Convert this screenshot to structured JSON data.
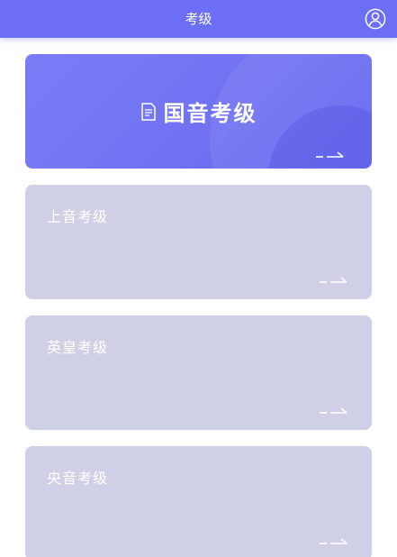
{
  "header": {
    "title": "考级",
    "user_icon": "user-icon"
  },
  "cards": [
    {
      "label": "国音考级",
      "style": "featured",
      "icon": "document-icon",
      "arrow_icon": "arrow-right-icon"
    },
    {
      "label": "上音考级",
      "style": "plain",
      "arrow_icon": "arrow-right-icon"
    },
    {
      "label": "英皇考级",
      "style": "plain",
      "arrow_icon": "arrow-right-icon"
    },
    {
      "label": "央音考级",
      "style": "plain",
      "arrow_icon": "arrow-right-icon"
    }
  ],
  "colors": {
    "header_bg": "#6c6ef5",
    "featured_card": "#7375f4",
    "plain_card": "#cfd0e6",
    "text": "#ffffff"
  }
}
